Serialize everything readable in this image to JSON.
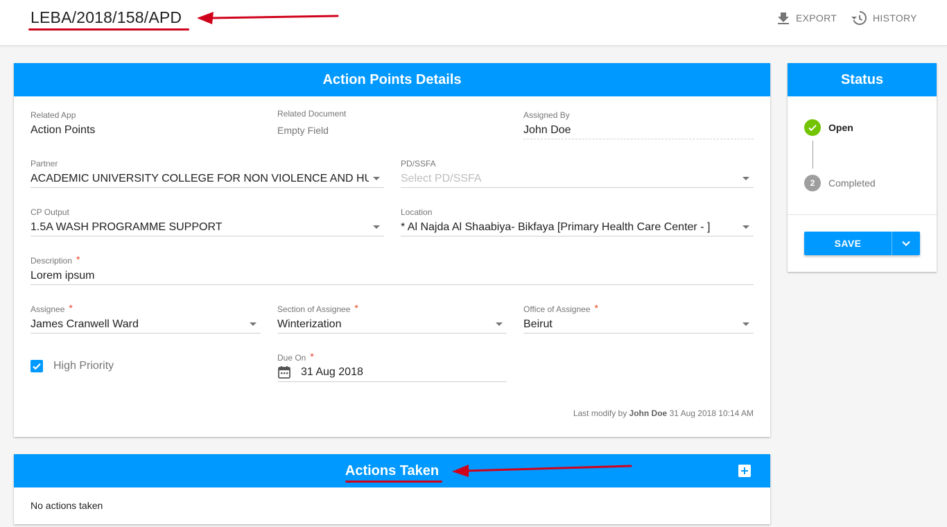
{
  "header": {
    "reference": "LEBA/2018/158/APD",
    "export_label": "EXPORT",
    "history_label": "HISTORY"
  },
  "details": {
    "title": "Action Points Details",
    "related_app": {
      "label": "Related App",
      "value": "Action Points"
    },
    "related_document": {
      "label": "Related Document",
      "value": "Empty Field"
    },
    "assigned_by": {
      "label": "Assigned By",
      "value": "John Doe"
    },
    "partner": {
      "label": "Partner",
      "value": "ACADEMIC UNIVERSITY COLLEGE FOR NON VIOLENCE AND HUMAN RIGHTS"
    },
    "pd_ssfa": {
      "label": "PD/SSFA",
      "placeholder": "Select PD/SSFA"
    },
    "cp_output": {
      "label": "CP Output",
      "value": "1.5A WASH PROGRAMME SUPPORT"
    },
    "location": {
      "label": "Location",
      "value": "* Al Najda Al Shaabiya- Bikfaya [Primary Health Care Center - ]"
    },
    "description": {
      "label": "Description",
      "value": "Lorem ipsum"
    },
    "assignee": {
      "label": "Assignee",
      "value": "James Cranwell Ward"
    },
    "section": {
      "label": "Section of Assignee",
      "value": "Winterization"
    },
    "office": {
      "label": "Office of Assignee",
      "value": "Beirut"
    },
    "high_priority": {
      "label": "High Priority",
      "checked": true
    },
    "due_on": {
      "label": "Due On",
      "value": "31 Aug 2018"
    },
    "last_modify": {
      "prefix": "Last modify by",
      "user": "John Doe",
      "datetime": "31 Aug 2018 10:14 AM"
    },
    "required_mark": "*"
  },
  "status": {
    "title": "Status",
    "steps": [
      {
        "label": "Open",
        "state": "done"
      },
      {
        "label": "Completed",
        "number": "2",
        "state": "pending"
      }
    ],
    "save_label": "SAVE"
  },
  "actions_taken": {
    "title": "Actions Taken",
    "empty_text": "No actions taken"
  },
  "colors": {
    "accent": "#0099ff",
    "success": "#72c300",
    "annotation": "#d0021b",
    "required": "#ea4022"
  },
  "icons": [
    "download-icon",
    "history-icon",
    "calendar-icon",
    "check-icon",
    "chevron-down-icon",
    "add-box-icon",
    "arrow-annotation-icon"
  ]
}
